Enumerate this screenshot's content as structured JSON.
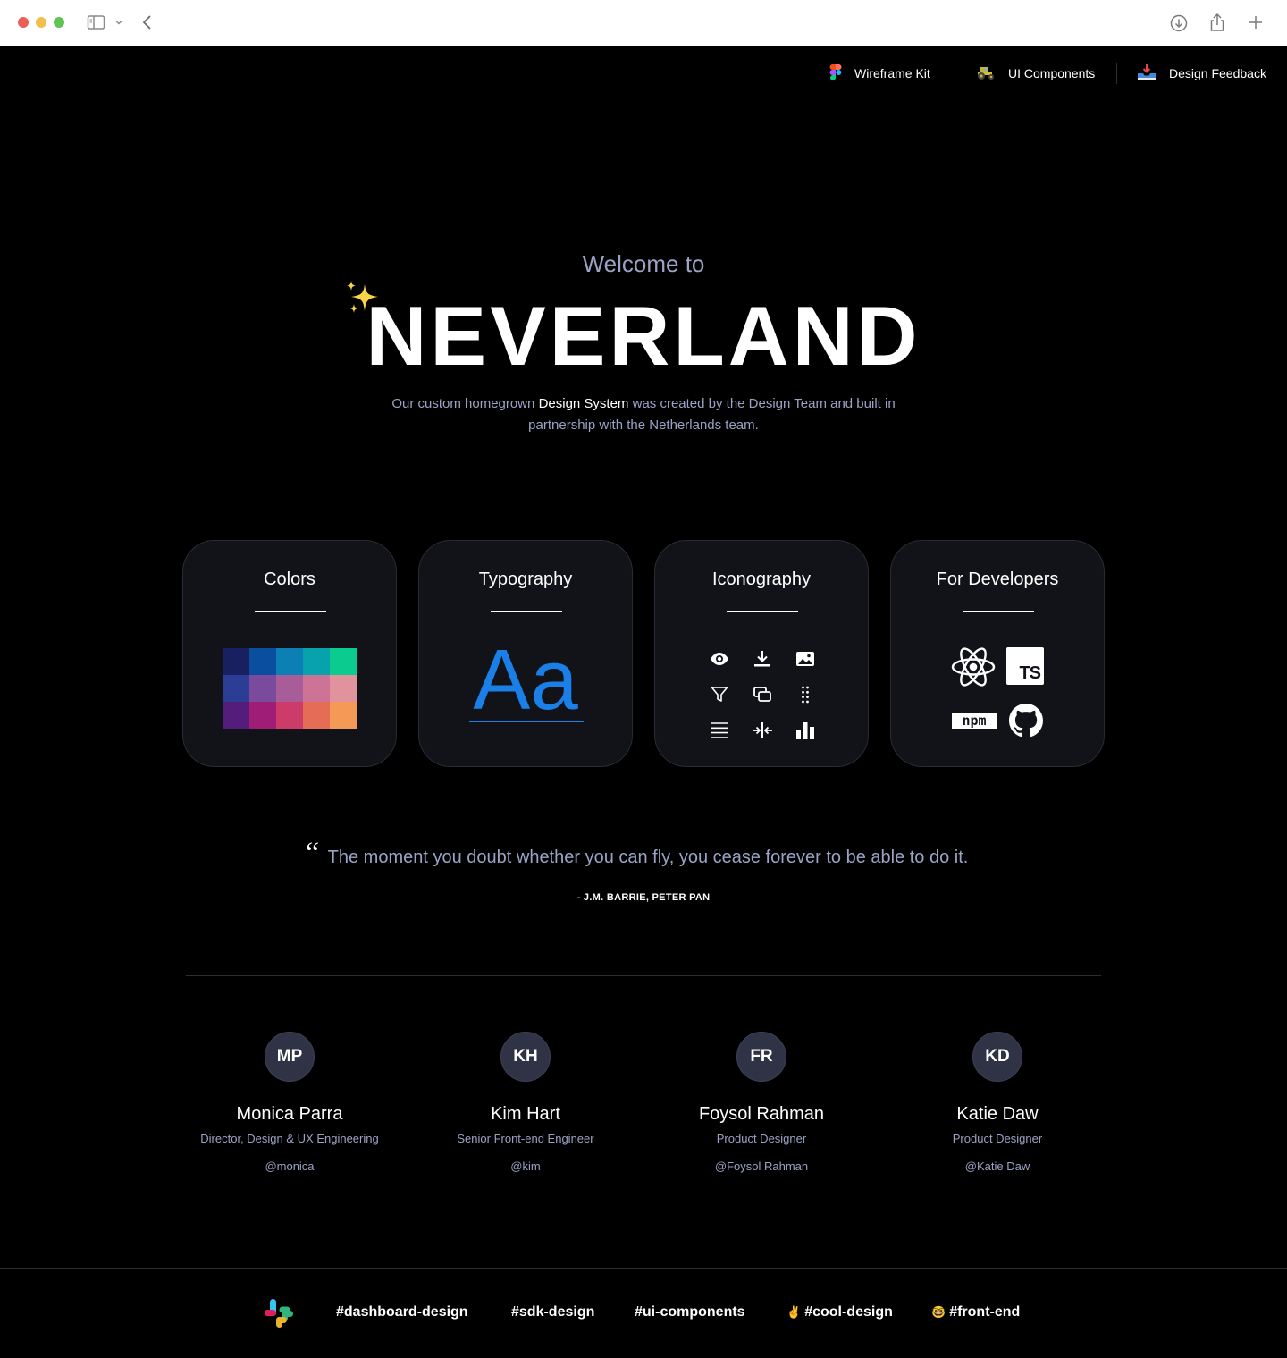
{
  "nav": {
    "items": [
      {
        "label": "Wireframe Kit",
        "icon": "figma-icon"
      },
      {
        "label": "UI Components",
        "icon": "tractor-icon"
      },
      {
        "label": "Design Feedback",
        "icon": "inbox-tray-icon"
      }
    ]
  },
  "hero": {
    "welcome": "Welcome to",
    "title": "NEVERLAND",
    "sparkle": "✨",
    "intro_before": "Our custom homegrown ",
    "intro_highlight": "Design System",
    "intro_after": " was created by the Design Team and built in partnership with the Netherlands team."
  },
  "cards": {
    "colors": {
      "title": "Colors",
      "swatches": [
        "#182060",
        "#0a4ea0",
        "#0c7fb5",
        "#07a2ab",
        "#0bcb8f",
        "#2c3d95",
        "#7a4a9c",
        "#a85c98",
        "#cc7396",
        "#e0939c",
        "#551d7b",
        "#9f1d77",
        "#cd3c69",
        "#e56c55",
        "#f59a56"
      ]
    },
    "typography": {
      "title": "Typography",
      "sample": "Aa"
    },
    "iconography": {
      "title": "Iconography",
      "icons": [
        "eye-icon",
        "download-icon",
        "image-icon",
        "filter-icon",
        "copy-icon",
        "drag-handle-icon",
        "menu-icon",
        "resize-horizontal-icon",
        "bar-chart-icon"
      ]
    },
    "developers": {
      "title": "For Developers",
      "ts_badge": "TS",
      "npm_badge": "npm"
    }
  },
  "quote": {
    "mark": "“",
    "text": "The moment you doubt whether you can fly, you cease forever to be able to do it.",
    "author": "- J.M. BARRIE, PETER PAN"
  },
  "team": [
    {
      "initials": "MP",
      "name": "Monica Parra",
      "role": "Director,  Design & UX Engineering",
      "handle": "@monica"
    },
    {
      "initials": "KH",
      "name": "Kim Hart",
      "role": "Senior Front-end Engineer",
      "handle": "@kim"
    },
    {
      "initials": "FR",
      "name": "Foysol Rahman",
      "role": "Product Designer",
      "handle": "@Foysol Rahman"
    },
    {
      "initials": "KD",
      "name": "Katie Daw",
      "role": "Product Designer",
      "handle": "@Katie Daw"
    }
  ],
  "footer": {
    "channels": [
      {
        "emoji": "",
        "label": "#dashboard-design"
      },
      {
        "emoji": "",
        "label": "#sdk-design"
      },
      {
        "emoji": "",
        "label": "#ui-components"
      },
      {
        "emoji": "✌️",
        "label": "#cool-design"
      },
      {
        "emoji": "🤓",
        "label": "#front-end"
      }
    ]
  },
  "colors": {
    "background": "#000000",
    "card": "#121319",
    "muted_text": "#9aa3c4",
    "accent_blue": "#1a7fe6",
    "avatar_bg": "#2f3345"
  }
}
